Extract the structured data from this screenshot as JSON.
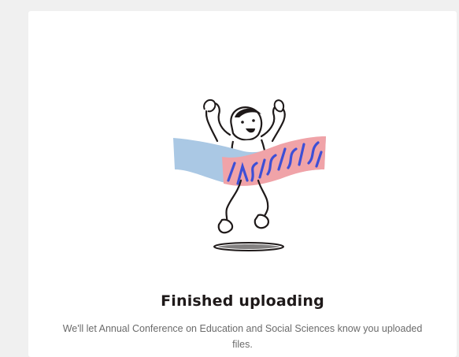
{
  "upload_complete": {
    "title": "Finished uploading",
    "message_line1": "We'll let Annual Conference on Education and Social Sciences know you uploaded",
    "message_line2": "files.",
    "illustration": "celebrating-runner-illustration"
  },
  "colors": {
    "background": "#f0f0f0",
    "card": "#ffffff",
    "title": "#1e1919",
    "text": "#6b6b6b",
    "ribbon_blue": "#aac8e4",
    "ribbon_pink": "#f0a3a8",
    "ribbon_stripe": "#3d4fd6"
  }
}
